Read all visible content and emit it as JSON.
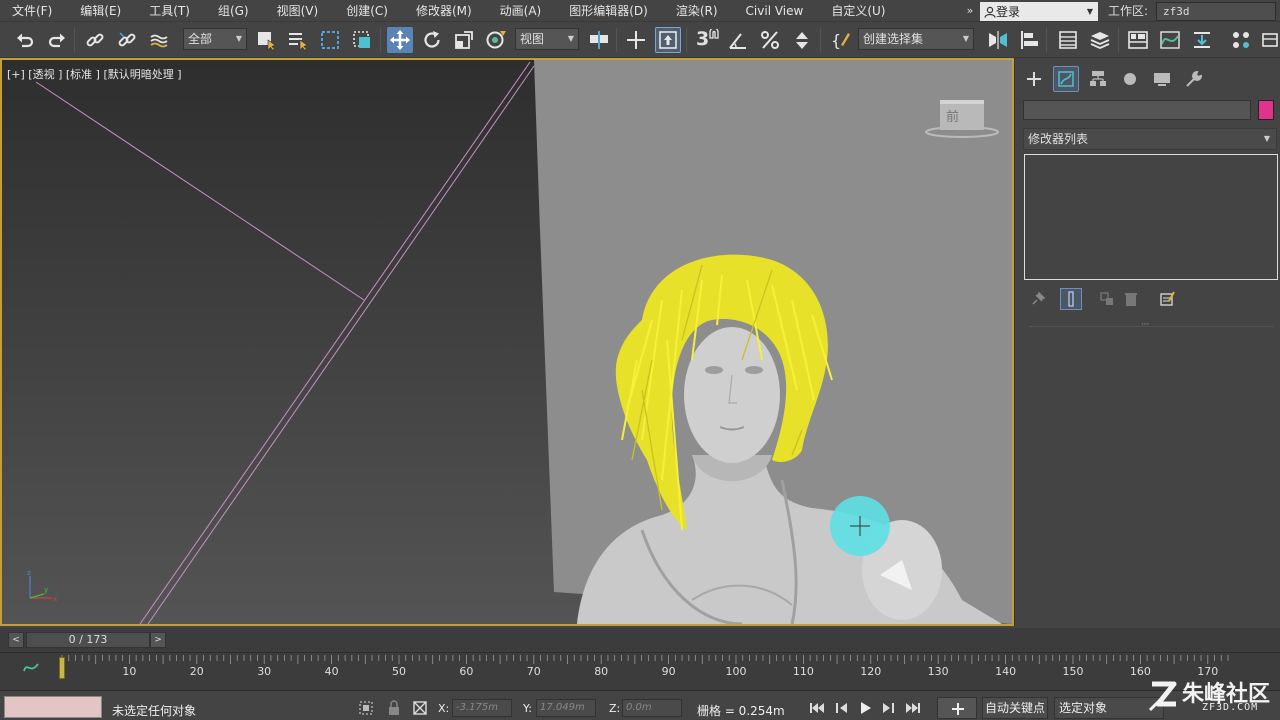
{
  "menubar": {
    "items": [
      "文件(F)",
      "编辑(E)",
      "工具(T)",
      "组(G)",
      "视图(V)",
      "创建(C)",
      "修改器(M)",
      "动画(A)",
      "图形编辑器(D)",
      "渲染(R)",
      "Civil View",
      "自定义(U)"
    ],
    "more": "»",
    "login": "登录",
    "workspace_label": "工作区:",
    "workspace_value": "zf3d"
  },
  "toolbar": {
    "selection_filter": "全部",
    "ref_coord": "视图",
    "named_selection": "创建选择集",
    "snap_label": "3"
  },
  "viewport": {
    "label": "[+] [透视 ] [标准 ] [默认明暗处理 ]",
    "viewcube_label": "前"
  },
  "command_panel": {
    "name_value": "",
    "modifier_list": "修改器列表",
    "color": "#e0338c"
  },
  "timeline": {
    "frame_display": "0 / 173",
    "prev": "<",
    "next": ">",
    "current_frame": 0,
    "total_frames": 173,
    "ticks": [
      "10",
      "20",
      "30",
      "40",
      "50",
      "60",
      "70",
      "80",
      "90",
      "100",
      "110",
      "120",
      "130",
      "140",
      "150",
      "160",
      "170"
    ]
  },
  "status": {
    "message": "未选定任何对象",
    "x_label": "X:",
    "x_value": "-3.175m",
    "y_label": "Y:",
    "y_value": "17.049m",
    "z_label": "Z:",
    "z_value": "0.0m",
    "grid": "栅格 = 0.254m",
    "autokey": "自动关键点",
    "selected_set": "选定对象"
  },
  "watermark": {
    "text": "朱峰社区",
    "sub": "ZF3D.COM"
  }
}
